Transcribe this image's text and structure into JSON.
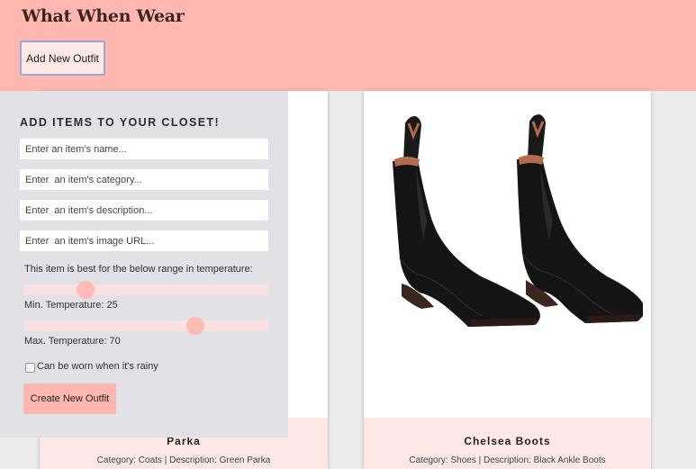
{
  "header": {
    "app_title": "What When Wear",
    "add_outfit_label": "Add New Outfit"
  },
  "form": {
    "heading": "ADD ITEMS TO YOUR CLOSET!",
    "name_placeholder": "Enter an item's name...",
    "category_placeholder": "Enter  an item's category...",
    "description_placeholder": "Enter  an item's description...",
    "image_placeholder": "Enter  an item's image URL...",
    "range_caption": "This item is best for the below range in temperature:",
    "min_label": "Min. Temperature: 25",
    "max_label": "Max. Temperature: 70",
    "min_value": 25,
    "max_value": 70,
    "slider_scale": [
      0,
      100
    ],
    "rainy_label": "Can be worn when it's rainy",
    "rainy_checked": false,
    "create_label": "Create New Outfit"
  },
  "cards": [
    {
      "name": "Parka",
      "description": "Category: Coats | Description: Green Parka"
    },
    {
      "name": "Chelsea Boots",
      "description": "Category: Shoes | Description: Black Ankle Boots",
      "image_icon": "black-chelsea-boots-image"
    }
  ],
  "colors": {
    "header_bg": "#ffb7b0",
    "panel_bg": "#e1e1e6",
    "card_footer_bg": "#fde8e6",
    "accent": "#ffbcb4"
  }
}
